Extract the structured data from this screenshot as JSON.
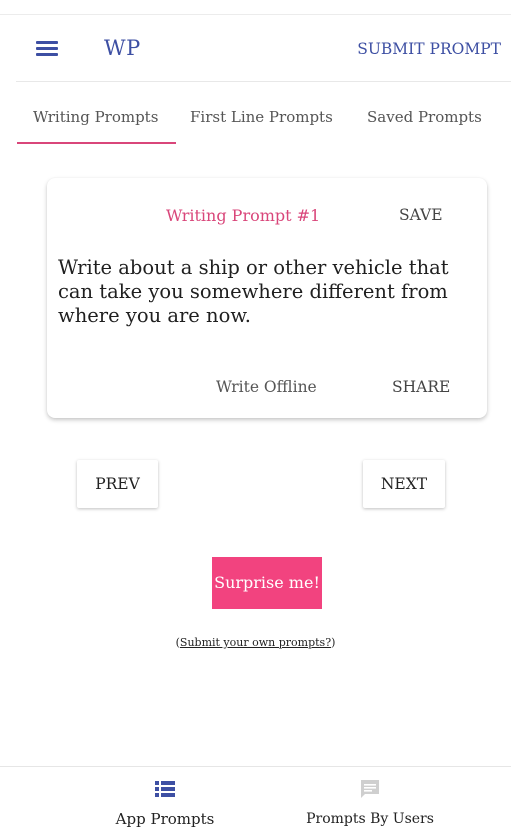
{
  "app_bar": {
    "title": "WP",
    "submit_prompt_label": "SUBMIT PROMPT",
    "menu_icon": "hamburger-menu-icon"
  },
  "tabs": [
    {
      "label": "Writing Prompts",
      "active": true
    },
    {
      "label": "First Line Prompts",
      "active": false
    },
    {
      "label": "Saved Prompts",
      "active": false
    }
  ],
  "card": {
    "title": "Writing Prompt #1",
    "save_label": "SAVE",
    "prompt_text": "Write about a ship or other vehicle that can take you somewhere different from where you are now.",
    "write_offline_label": "Write Offline",
    "share_label": "SHARE"
  },
  "navigation": {
    "prev_label": "PREV",
    "next_label": "NEXT"
  },
  "surprise_label": "Surprise me!",
  "submit_own": {
    "open_paren": "(",
    "link_text": "Submit your own prompts?",
    "close_paren": ")"
  },
  "bottom_nav": [
    {
      "label": "App Prompts",
      "icon": "list-icon",
      "active": true
    },
    {
      "label": "Prompts By Users",
      "icon": "message-icon",
      "active": false
    }
  ],
  "colors": {
    "primary": "#3d4fa3",
    "accent": "#d9467a",
    "surprise_button": "#f2437f",
    "inactive_icon": "#cfcfcf"
  }
}
